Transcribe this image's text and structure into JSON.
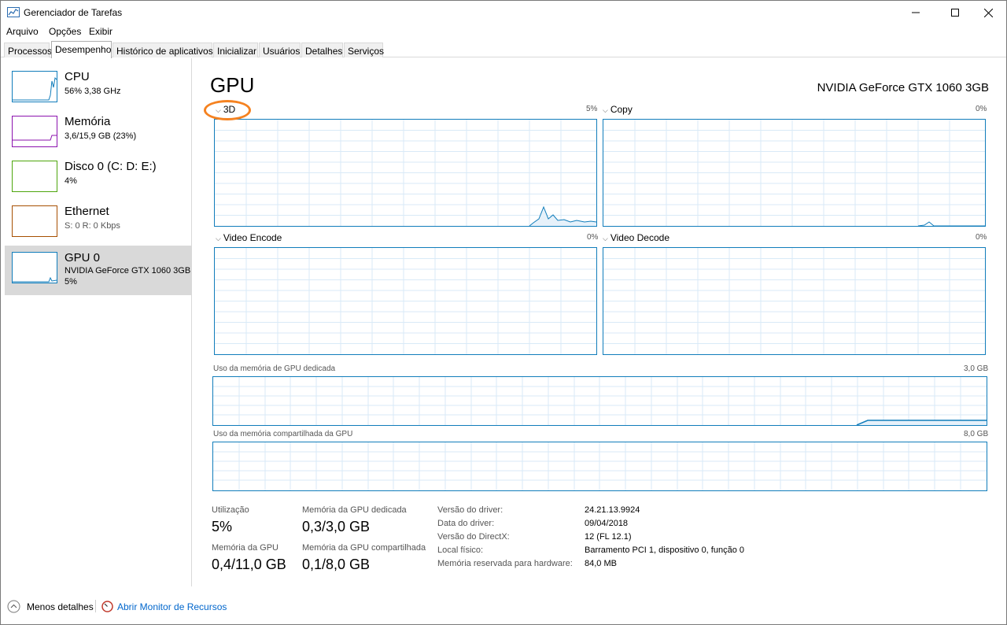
{
  "window": {
    "title": "Gerenciador de Tarefas"
  },
  "menu": [
    "Arquivo",
    "Opções",
    "Exibir"
  ],
  "tabs": [
    "Processos",
    "Desempenho",
    "Histórico de aplicativos",
    "Inicializar",
    "Usuários",
    "Detalhes",
    "Serviços"
  ],
  "sidebar": {
    "items": [
      {
        "title": "CPU",
        "sub": "56% 3,38 GHz",
        "color": "#117dbb"
      },
      {
        "title": "Memória",
        "sub": "3,6/15,9 GB (23%)",
        "color": "#8b12ae"
      },
      {
        "title": "Disco 0 (C: D: E:)",
        "sub": "4%",
        "color": "#4da60c"
      },
      {
        "title": "Ethernet",
        "sub": "S: 0 R: 0 Kbps",
        "color": "#a74f01"
      },
      {
        "title": "GPU 0",
        "sub": "NVIDIA GeForce GTX 1060 3GB",
        "sub2": "5%",
        "color": "#117dbb"
      }
    ]
  },
  "main": {
    "title": "GPU",
    "gpu_name": "NVIDIA GeForce GTX 1060 3GB",
    "engines": [
      {
        "label": "3D",
        "pct": "5%"
      },
      {
        "label": "Copy",
        "pct": "0%"
      },
      {
        "label": "Video Encode",
        "pct": "0%"
      },
      {
        "label": "Video Decode",
        "pct": "0%"
      }
    ],
    "dedicated_label": "Uso da memória de GPU dedicada",
    "dedicated_max": "3,0 GB",
    "shared_label": "Uso da memória compartilhada da GPU",
    "shared_max": "8,0 GB"
  },
  "stats": {
    "utilizacao_label": "Utilização",
    "utilizacao_value": "5%",
    "dedicada_label": "Memória da GPU dedicada",
    "dedicada_value": "0,3/3,0 GB",
    "memoria_label": "Memória da GPU",
    "memoria_value": "0,4/11,0 GB",
    "compartilhada_label": "Memória da GPU compartilhada",
    "compartilhada_value": "0,1/8,0 GB"
  },
  "info": [
    {
      "key": "Versão do driver:",
      "val": "24.21.13.9924"
    },
    {
      "key": "Data do driver:",
      "val": "09/04/2018"
    },
    {
      "key": "Versão do DirectX:",
      "val": "12 (FL 12.1)"
    },
    {
      "key": "Local físico:",
      "val": "Barramento PCI 1, dispositivo 0, função 0"
    },
    {
      "key": "Memória reservada para hardware:",
      "val": "84,0 MB"
    }
  ],
  "footer": {
    "less_details": "Menos detalhes",
    "resource_monitor": "Abrir Monitor de Recursos"
  },
  "colors": {
    "accent": "#117dbb",
    "highlight_circle": "#f58220"
  }
}
